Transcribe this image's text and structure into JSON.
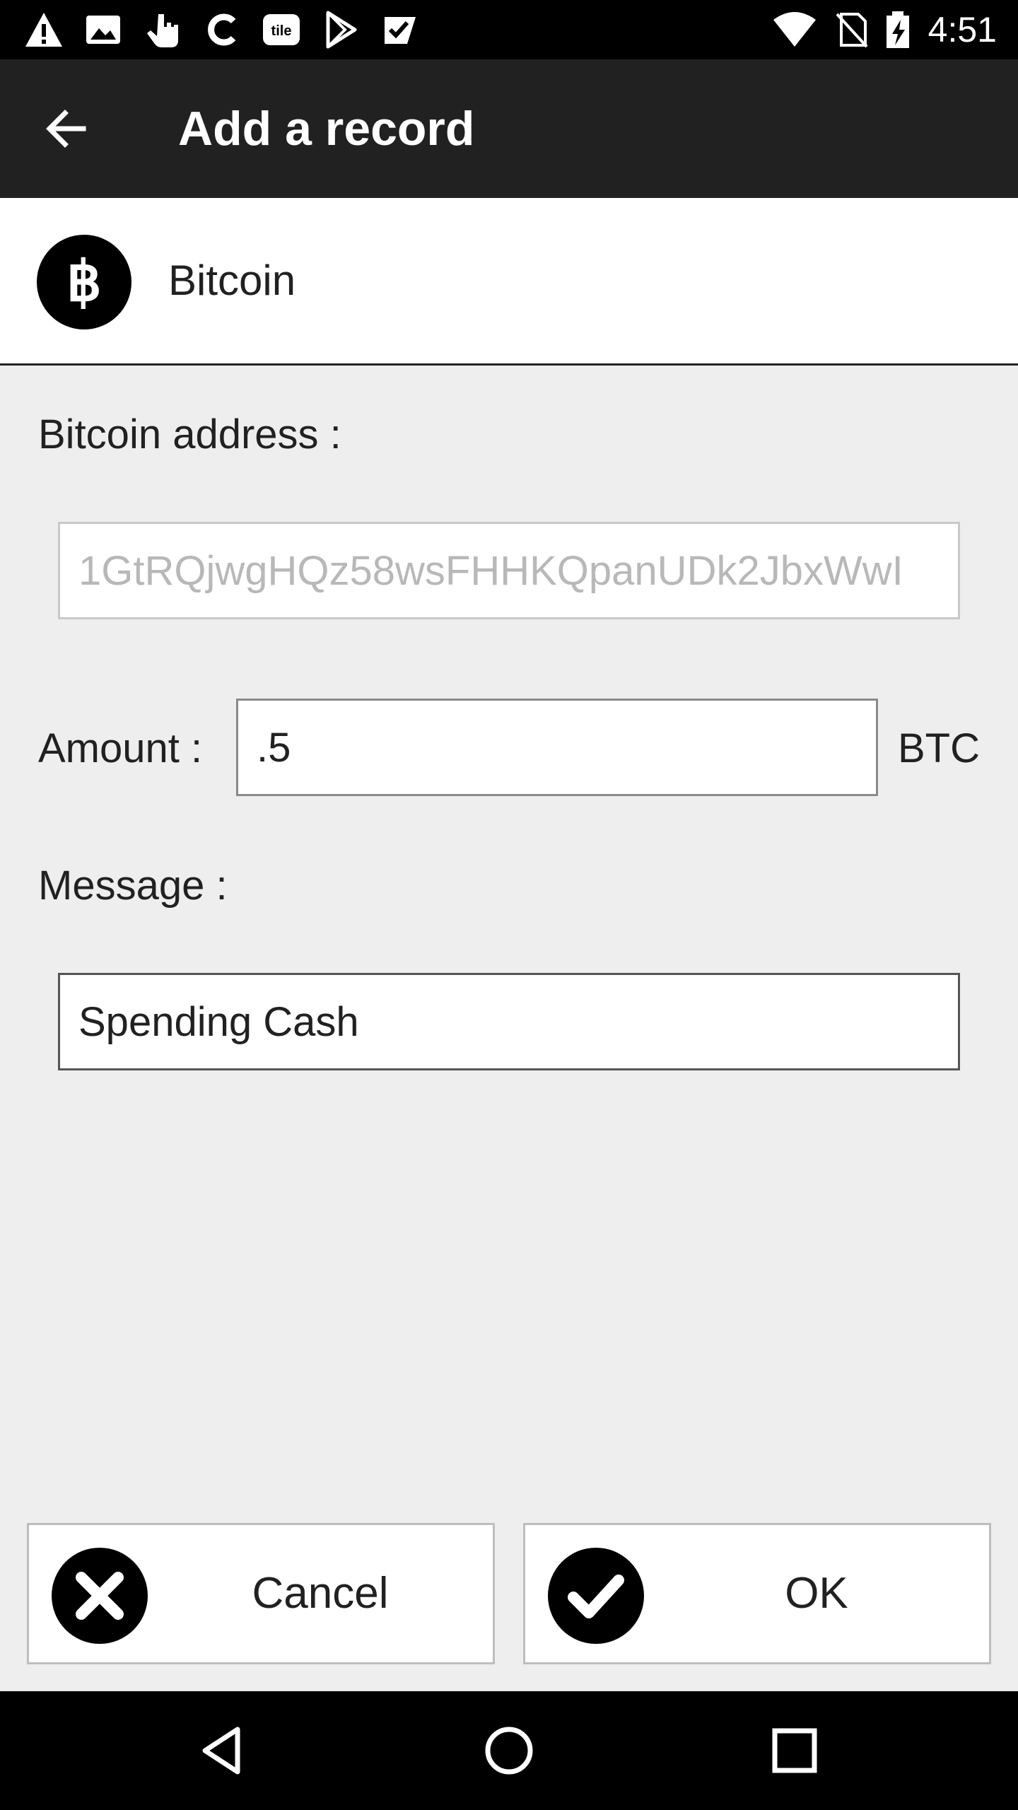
{
  "status_bar": {
    "time": "4:51",
    "icons": [
      "warning-icon",
      "image-icon",
      "hand-pointer-icon",
      "c-app-icon",
      "tile-app-icon",
      "play-store-icon",
      "check-app-icon",
      "wifi-icon",
      "no-sim-icon",
      "battery-charging-icon"
    ],
    "tile_text": "tile"
  },
  "app_bar": {
    "title": "Add a record",
    "back_icon": "arrow-left-icon"
  },
  "coin": {
    "name": "Bitcoin",
    "logo_icon": "bitcoin-icon"
  },
  "form": {
    "address_label": "Bitcoin address :",
    "address_value": "1GtRQjwgHQz58wsFHHKQpanUDk2JbxWwI",
    "amount_label": "Amount :",
    "amount_value": ".5",
    "amount_unit": "BTC",
    "message_label": "Message :",
    "message_value": "Spending Cash"
  },
  "buttons": {
    "cancel_label": "Cancel",
    "ok_label": "OK"
  },
  "nav_bar": {
    "icons": [
      "back-triangle-icon",
      "home-circle-icon",
      "recents-square-icon"
    ]
  },
  "colors": {
    "app_bar": "#212121",
    "background": "#eeeeee",
    "status_bar": "#000000"
  }
}
